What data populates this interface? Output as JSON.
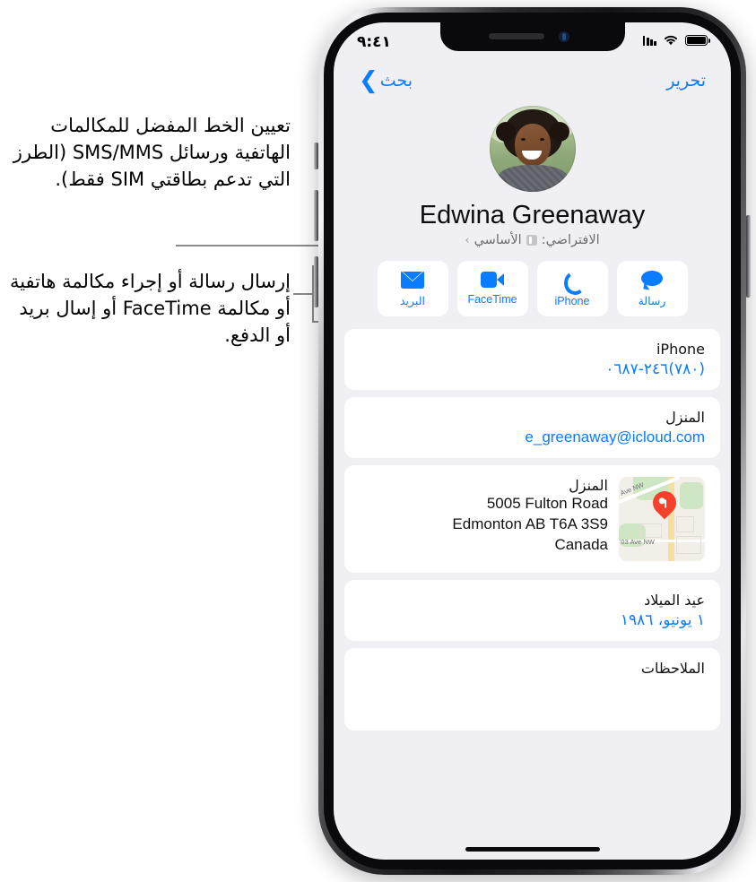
{
  "callouts": [
    {
      "id": "sim-default",
      "text": "تعيين الخط المفضل للمكالمات الهاتفية ورسائل SMS/MMS (الطرز التي تدعم بطاقتي SIM فقط)."
    },
    {
      "id": "actions",
      "text": "إرسال رسالة أو إجراء مكالمة هاتفية أو مكالمة FaceTime أو إسال بريد أو الدفع."
    }
  ],
  "status_bar": {
    "time": "٩:٤١",
    "battery_icon": "battery-icon",
    "wifi_icon": "wifi-icon",
    "cellular_icon": "cellular-signal-icon"
  },
  "nav_bar": {
    "edit_label": "تحرير",
    "search_label": "بحث",
    "back_chevron": "chevron-icon"
  },
  "contact": {
    "name": "Edwina Greenaway",
    "avatar": "contact-photo",
    "default_line": {
      "prefix": "الافتراضي:",
      "sim_badge": "sim-card-icon",
      "value": "الأساسي",
      "arrow": "›"
    },
    "actions": [
      {
        "label": "رسالة",
        "icon": "message-bubble-icon",
        "ltr": false
      },
      {
        "label": "iPhone",
        "icon": "phone-handset-icon",
        "ltr": true
      },
      {
        "label": "FaceTime",
        "icon": "video-camera-icon",
        "ltr": true
      },
      {
        "label": "البريد",
        "icon": "mail-envelope-icon",
        "ltr": false
      }
    ],
    "fields": {
      "phone": {
        "label": "iPhone",
        "value": "(٧٨٠)٢٤٦-٠٦٨٧"
      },
      "email": {
        "label": "المنزل",
        "value": "e_greenaway@icloud.com"
      },
      "address": {
        "label": "المنزل",
        "line1": "5005 Fulton Road",
        "line2": "Edmonton AB T6A 3S9",
        "line3": "Canada",
        "map_label_1": "Ave NW",
        "map_label_2": "'03 Ave NW",
        "map_pin": "map-pin-icon"
      },
      "birthday": {
        "label": "عيد الميلاد",
        "value": "١ يونيو، ١٩٨٦"
      },
      "notes": {
        "label": "الملاحظات",
        "value": ""
      }
    }
  },
  "colors": {
    "accent": "#0a7cff",
    "screen_bg": "#f0eff4",
    "card_bg": "#ffffff",
    "pin": "#f5402c",
    "secondary_text": "#6d6d72"
  }
}
